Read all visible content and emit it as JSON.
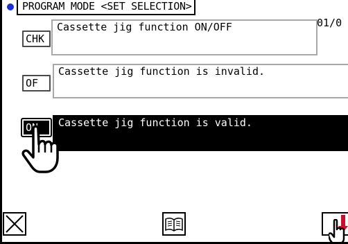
{
  "header": {
    "title": "PROGRAM MODE <SET SELECTION>",
    "page": "01/0"
  },
  "options": [
    {
      "button": "CHK",
      "text": "Cassette jig function ON/OFF"
    },
    {
      "button": "OF",
      "text": "Cassette jig function is invalid."
    },
    {
      "button": "ON",
      "text": "Cassette jig function is valid.",
      "selected": true
    }
  ],
  "footer": {
    "icons": [
      "close-icon",
      "manual-book-icon",
      "confirm-arrow-icon"
    ]
  },
  "colors": {
    "title_dot": "#1a2fd6",
    "selected_bg": "#000000",
    "accent_red": "#c8102e"
  }
}
